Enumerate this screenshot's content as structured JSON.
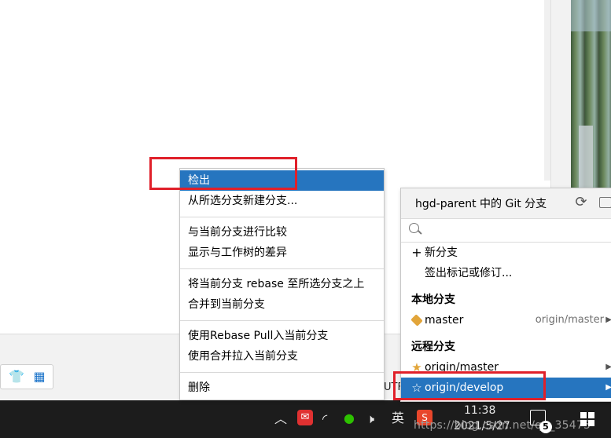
{
  "context_menu": {
    "items": [
      {
        "label": "检出"
      },
      {
        "label": "从所选分支新建分支..."
      },
      {
        "label": "与当前分支进行比较"
      },
      {
        "label": "显示与工作树的差异"
      },
      {
        "label": "将当前分支 rebase 至所选分支之上"
      },
      {
        "label": "合并到当前分支"
      },
      {
        "label": "使用Rebase Pull入当前分支"
      },
      {
        "label": "使用合并拉入当前分支"
      },
      {
        "label": "删除"
      }
    ]
  },
  "git_popup": {
    "title": "hgd-parent 中的 Git 分支",
    "search_placeholder": "",
    "actions": [
      {
        "label": "新分支",
        "icon": "plus-icon"
      },
      {
        "label": "签出标记或修订..."
      }
    ],
    "local_section": "本地分支",
    "local_branches": [
      {
        "name": "master",
        "tracking": "origin/master",
        "icon": "tag-icon"
      }
    ],
    "remote_section": "远程分支",
    "remote_branches": [
      {
        "name": "origin/master",
        "icon": "star-filled-icon"
      },
      {
        "name": "origin/develop",
        "icon": "star-outline-icon",
        "selected": true
      }
    ]
  },
  "status_bar": {
    "encoding_fragment": "UTF"
  },
  "taskbar": {
    "input_method": "英",
    "time": "11:38",
    "date": "2021/5/27",
    "watermark": "https://blog.csdn.net/qq_35475",
    "notification_count": "5"
  },
  "colors": {
    "selection": "#2675bf",
    "highlight_box": "#e0202a",
    "star": "#e2a53a",
    "taskbar": "#1c1c1c"
  }
}
